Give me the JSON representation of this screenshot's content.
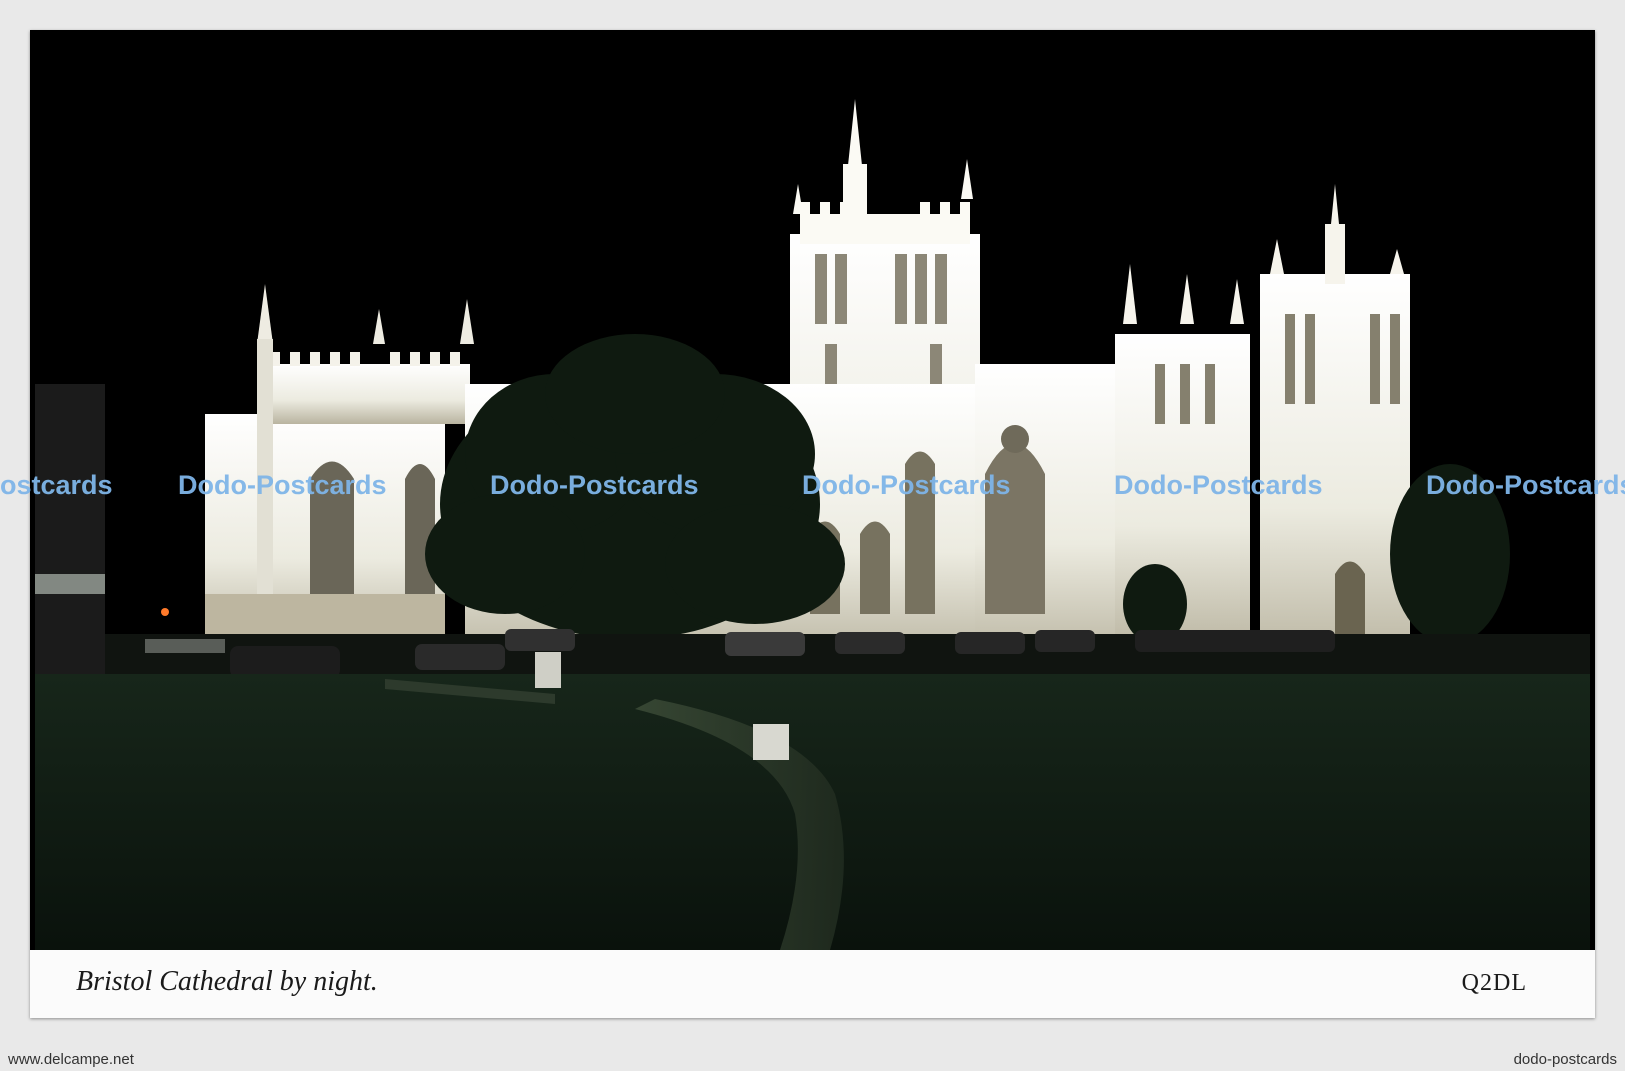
{
  "postcard": {
    "caption": "Bristol Cathedral by night.",
    "code": "Q2DL"
  },
  "watermarks": [
    "ostcards",
    "Dodo-Postcards",
    "Dodo-Postcards",
    "Dodo-Postcards",
    "Dodo-Postcards",
    "Dodo-Postcards"
  ],
  "footer": {
    "left": "www.delcampe.net",
    "right": "dodo-postcards"
  },
  "colors": {
    "watermark": "#7fb5e8",
    "sky": "#000000",
    "stone": "#f2f0e6"
  }
}
